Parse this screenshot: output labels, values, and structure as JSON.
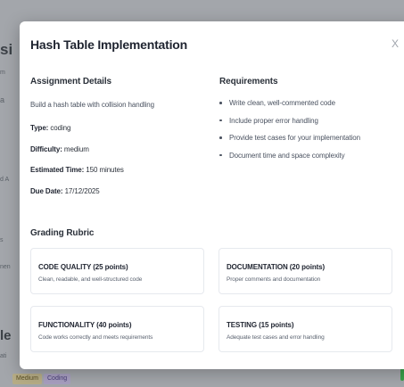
{
  "background": {
    "edge_fragments": [
      "si",
      "m",
      "a",
      "d A",
      "s",
      "nen",
      "le",
      "ati"
    ],
    "chips": {
      "medium": "Medium",
      "coding": "Coding"
    }
  },
  "modal": {
    "title": "Hash Table Implementation",
    "close_label": "X",
    "details": {
      "heading": "Assignment Details",
      "description": "Build a hash table with collision handling",
      "type_label": "Type:",
      "type_value": "coding",
      "difficulty_label": "Difficulty:",
      "difficulty_value": "medium",
      "time_label": "Estimated Time:",
      "time_value": "150 minutes",
      "due_label": "Due Date:",
      "due_value": "17/12/2025"
    },
    "requirements": {
      "heading": "Requirements",
      "items": [
        "Write clean, well-commented code",
        "Include proper error handling",
        "Provide test cases for your implementation",
        "Document time and space complexity"
      ]
    },
    "rubric": {
      "heading": "Grading Rubric",
      "cards": [
        {
          "name": "CODE QUALITY (25 points)",
          "description": "Clean, readable, and well-structured code"
        },
        {
          "name": "DOCUMENTATION (20 points)",
          "description": "Proper comments and documentation"
        },
        {
          "name": "FUNCTIONALITY (40 points)",
          "description": "Code works correctly and meets requirements"
        },
        {
          "name": "TESTING (15 points)",
          "description": "Adequate test cases and error handling"
        }
      ]
    }
  }
}
